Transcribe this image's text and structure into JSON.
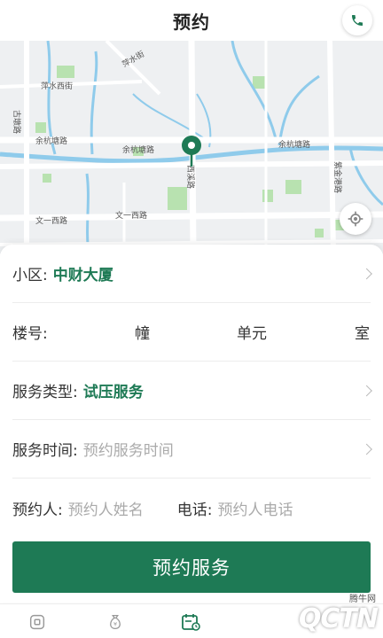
{
  "header": {
    "title": "预约",
    "phone_icon": "phone-icon"
  },
  "map": {
    "labels": {
      "pingshui": "萍水西街",
      "pingshui2": "萍水街",
      "gufang": "古墩路",
      "yuhang_w": "余杭塘路",
      "yuhang_m": "余杭塘路",
      "yuhang_e": "余杭塘路",
      "wenyi_w": "文一西路",
      "wenyi_m": "文一西路",
      "xiba": "西溪路",
      "huanggong": "紫金港路"
    },
    "pin_color": "#1e7a55",
    "locate_icon": "crosshair-icon"
  },
  "form": {
    "community": {
      "label": "小区:",
      "value": "中财大厦"
    },
    "building": {
      "label": "楼号:",
      "unit1": "幢",
      "unit2": "单元",
      "unit3": "室"
    },
    "service_type": {
      "label": "服务类型:",
      "value": "试压服务"
    },
    "service_time": {
      "label": "服务时间:",
      "placeholder": "预约服务时间"
    },
    "contact": {
      "label": "预约人:",
      "placeholder": "预约人姓名",
      "phone_label": "电话:",
      "phone_placeholder": "预约人电话"
    },
    "submit_label": "预约服务"
  },
  "tabbar": {
    "items": [
      "home-icon",
      "money-bag-icon",
      "calendar-icon"
    ]
  },
  "watermark": {
    "logo": "QCTN",
    "cn": "腾牛网"
  },
  "colors": {
    "accent": "#1e7a55"
  }
}
